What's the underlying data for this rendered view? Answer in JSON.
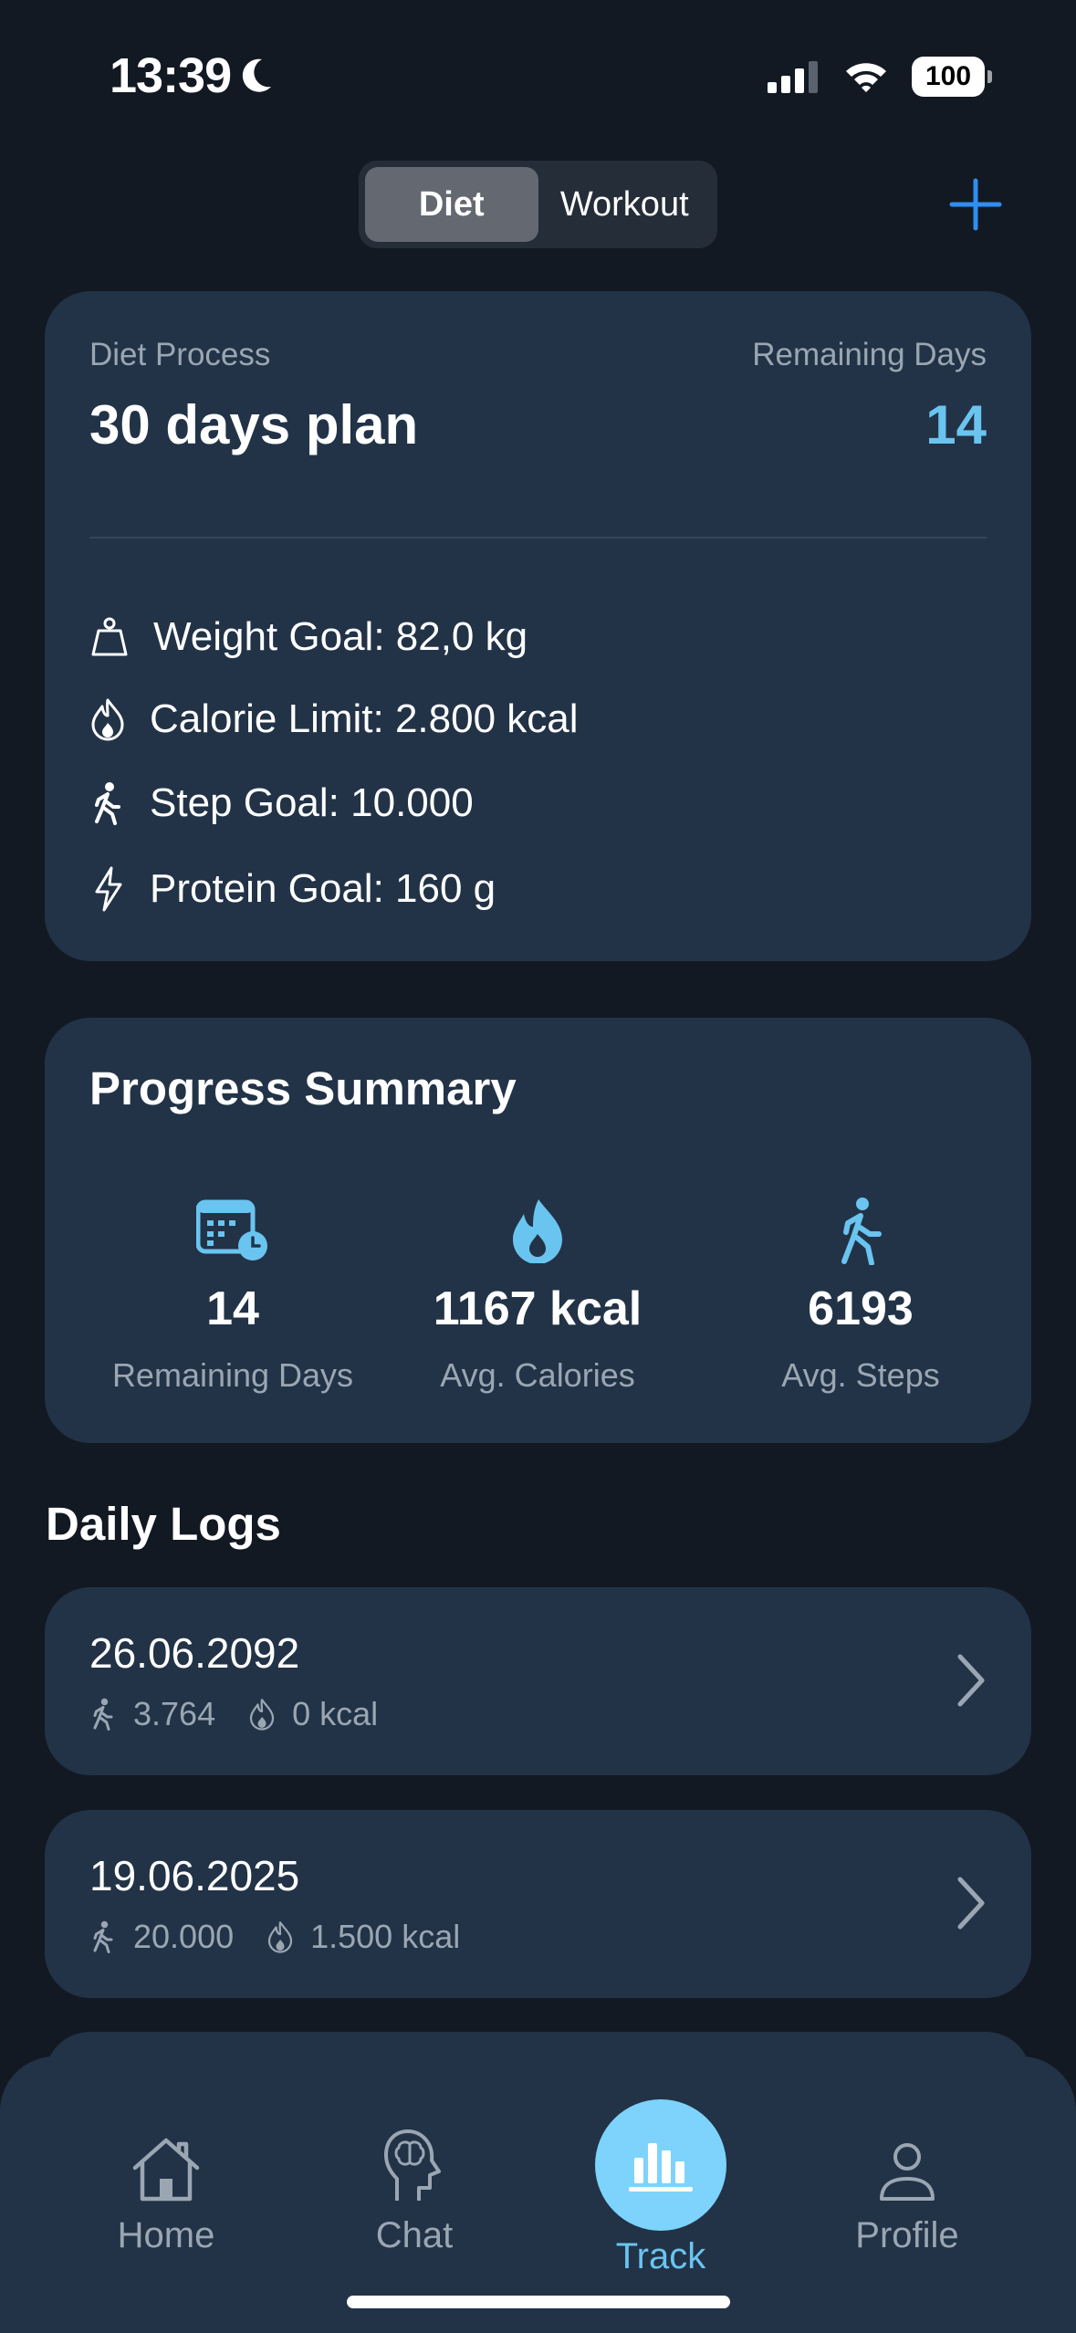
{
  "status_bar": {
    "time": "13:39",
    "battery": "100"
  },
  "segments": {
    "diet": "Diet",
    "workout": "Workout"
  },
  "plan": {
    "process_label": "Diet Process",
    "title": "30 days plan",
    "remaining_label": "Remaining Days",
    "remaining_value": "14",
    "goals": {
      "weight": "Weight Goal: 82,0 kg",
      "calorie": "Calorie Limit: 2.800 kcal",
      "steps": "Step Goal: 10.000",
      "protein": "Protein Goal: 160 g"
    }
  },
  "summary": {
    "title": "Progress Summary",
    "stats": [
      {
        "value": "14",
        "label": "Remaining Days",
        "icon": "calendar-clock-icon"
      },
      {
        "value": "1167 kcal",
        "label": "Avg. Calories",
        "icon": "flame-icon"
      },
      {
        "value": "6193",
        "label": "Avg. Steps",
        "icon": "walking-icon"
      }
    ]
  },
  "logs": {
    "title": "Daily Logs",
    "items": [
      {
        "date": "26.06.2092",
        "steps": "3.764",
        "calories": "0 kcal"
      },
      {
        "date": "19.06.2025",
        "steps": "20.000",
        "calories": "1.500 kcal"
      }
    ]
  },
  "tabs": {
    "home": "Home",
    "chat": "Chat",
    "track": "Track",
    "profile": "Profile"
  },
  "colors": {
    "background": "#121923",
    "card": "#223347",
    "accent": "#6ac4f0",
    "add": "#2f8ef0"
  }
}
